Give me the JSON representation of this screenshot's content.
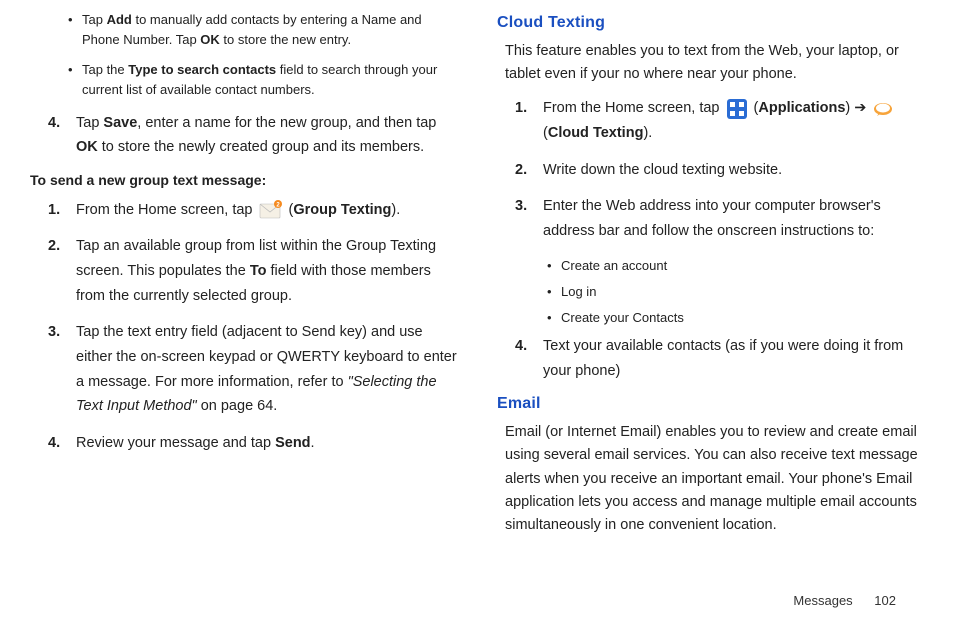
{
  "left": {
    "bullets": [
      {
        "pre": "Tap ",
        "bold1": "Add",
        "mid": " to manually add contacts by entering a Name and Phone Number. Tap ",
        "bold2": "OK",
        "post": " to store the new entry."
      },
      {
        "pre": "Tap the ",
        "bold1": "Type to search contacts",
        "mid": " field to search through your current list of available contact numbers.",
        "bold2": "",
        "post": ""
      }
    ],
    "step4": {
      "num": "4.",
      "pre": "Tap ",
      "b1": "Save",
      "mid": ", enter a name for the new group, and then tap ",
      "b2": "OK",
      "post": " to store the newly created group and its members."
    },
    "subhead": "To send a new group text message:",
    "g1": {
      "num": "1.",
      "pre": "From the Home screen, tap ",
      "iconLabel": "(",
      "b": "Group Texting",
      "post": ")."
    },
    "g2": {
      "num": "2.",
      "text_a": "Tap an available group from list within the Group Texting screen. This populates the ",
      "b": "To",
      "text_b": " field with those members from the currently selected group."
    },
    "g3": {
      "num": "3.",
      "text_a": "Tap the text entry field (adjacent to Send key) and use either the on-screen keypad or QWERTY keyboard to enter a message. For more information, refer to ",
      "i": "\"Selecting the Text Input Method\"",
      "text_b": "  on page 64."
    },
    "g4": {
      "num": "4.",
      "text_a": "Review your message and tap ",
      "b": "Send",
      "text_b": "."
    }
  },
  "right": {
    "cloudHead": "Cloud Texting",
    "cloudIntro": "This feature enables you to text from the Web, your laptop, or tablet even if your no where near your phone.",
    "c1": {
      "num": "1.",
      "pre": "From the Home screen, tap ",
      "b1": "Applications",
      "arrow": " ➔ ",
      "b2": "Cloud Texting",
      "post": ")."
    },
    "c2": {
      "num": "2.",
      "text": "Write down the cloud texting website."
    },
    "c3": {
      "num": "3.",
      "text": "Enter the Web address into your computer browser's address bar and follow the onscreen instructions to:"
    },
    "csub": [
      "Create an account",
      "Log in",
      "Create your Contacts"
    ],
    "c4": {
      "num": "4.",
      "text": "Text your available contacts (as if you were doing it from your phone)"
    },
    "emailHead": "Email",
    "emailIntro": "Email (or Internet Email) enables you to review and create email using several email services. You can also receive text message alerts when you receive an important email. Your phone's Email application lets you access and manage multiple email accounts simultaneously in one convenient location."
  },
  "footer": {
    "section": "Messages",
    "page": "102"
  }
}
